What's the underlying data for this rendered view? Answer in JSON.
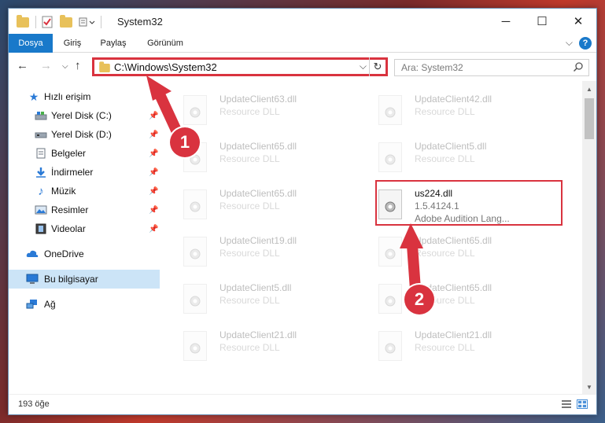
{
  "window": {
    "title": "System32",
    "controls": {
      "minimize": "─",
      "maximize": "☐",
      "close": "✕"
    }
  },
  "ribbon": {
    "tabs": [
      "Dosya",
      "Giriş",
      "Paylaş",
      "Görünüm"
    ],
    "help_label": "?"
  },
  "address_bar": {
    "path": "C:\\Windows\\System32",
    "search_placeholder": "Ara: System32"
  },
  "sidebar": {
    "quick_access": "Hızlı erişim",
    "items": [
      {
        "label": "Yerel Disk (C:)",
        "icon": "drive-icon",
        "pinned": true
      },
      {
        "label": "Yerel Disk (D:)",
        "icon": "drive-icon",
        "pinned": true
      },
      {
        "label": "Belgeler",
        "icon": "documents-icon",
        "pinned": true
      },
      {
        "label": "İndirmeler",
        "icon": "downloads-icon",
        "pinned": true
      },
      {
        "label": "Müzik",
        "icon": "music-icon",
        "pinned": true
      },
      {
        "label": "Resimler",
        "icon": "pictures-icon",
        "pinned": true
      },
      {
        "label": "Videolar",
        "icon": "videos-icon",
        "pinned": true
      }
    ],
    "onedrive": "OneDrive",
    "this_pc": "Bu bilgisayar",
    "network": "Ağ"
  },
  "files": [
    {
      "name": "UpdateClient63.dll",
      "desc": "Resource DLL"
    },
    {
      "name": "UpdateClient42.dll",
      "desc": "Resource DLL"
    },
    {
      "name": "UpdateClient65.dll",
      "desc": "Resource DLL"
    },
    {
      "name": "UpdateClient5.dll",
      "desc": "Resource DLL"
    },
    {
      "name": "UpdateClient65.dll",
      "desc": "Resource DLL"
    },
    {
      "name": "us224.dll",
      "desc": "1.5.4124.1",
      "sub": "Adobe Audition Lang..."
    },
    {
      "name": "UpdateClient19.dll",
      "desc": "Resource DLL"
    },
    {
      "name": "UpdateClient65.dll",
      "desc": "Resource DLL"
    },
    {
      "name": "UpdateClient5.dll",
      "desc": "Resource DLL"
    },
    {
      "name": "UpdateClient65.dll",
      "desc": "Resource DLL"
    },
    {
      "name": "UpdateClient21.dll",
      "desc": "Resource DLL"
    },
    {
      "name": "UpdateClient21.dll",
      "desc": "Resource DLL"
    }
  ],
  "status": {
    "item_count": "193 öğe"
  },
  "annotations": {
    "step1": "1",
    "step2": "2",
    "color": "#d9333f"
  }
}
